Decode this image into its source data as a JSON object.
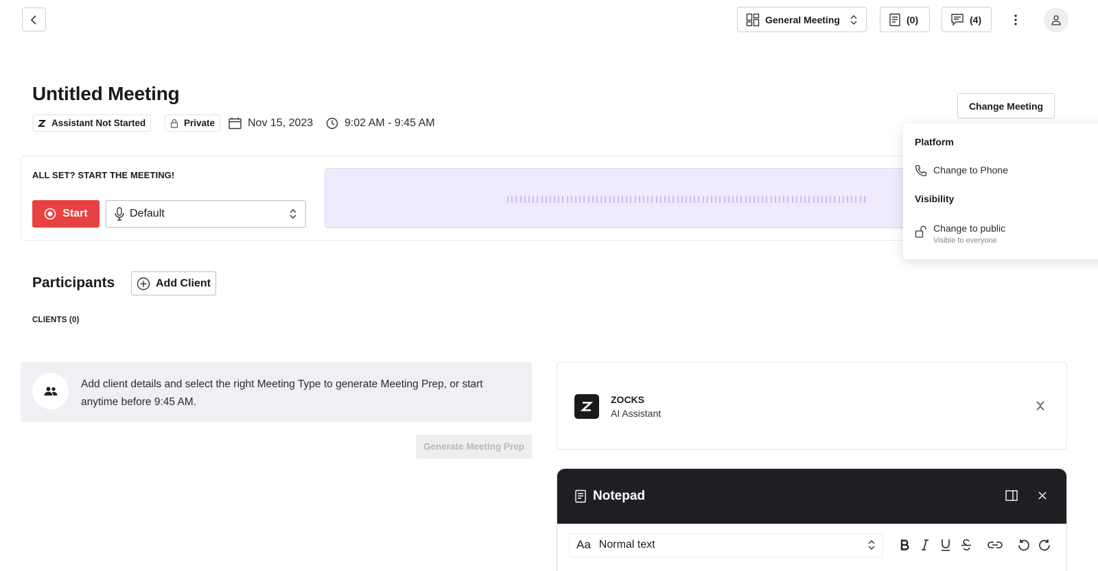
{
  "topbar": {
    "meeting_type": "General Meeting",
    "notes_count": "(0)",
    "comments_count": "(4)"
  },
  "meeting": {
    "title": "Untitled Meeting",
    "assistant_status": "Assistant Not Started",
    "privacy": "Private",
    "date": "Nov 15, 2023",
    "time": "9:02 AM - 9:45 AM",
    "change_meeting_label": "Change Meeting"
  },
  "start_panel": {
    "heading": "ALL SET? START THE MEETING!",
    "start_label": "Start",
    "mic_value": "Default"
  },
  "menu": {
    "platform_heading": "Platform",
    "change_phone": "Change to Phone",
    "visibility_heading": "Visibility",
    "change_public": "Change to public",
    "change_public_sub": "Visible to everyone"
  },
  "participants": {
    "heading": "Participants",
    "add_client_label": "Add Client",
    "clients_label": "CLIENTS (0)",
    "info_text": "Add client details and select the right Meeting Type to generate Meeting Prep, or start anytime before 9:45 AM.",
    "generate_label": "Generate Meeting Prep"
  },
  "assistant_card": {
    "name": "ZOCKS",
    "subtitle": "AI Assistant"
  },
  "notepad": {
    "title": "Notepad",
    "text_style_prefix": "Aa",
    "text_style": "Normal text"
  },
  "colors": {
    "start_red": "#e84141",
    "wave_bg": "#efeafc",
    "notepad_header": "#1e1f22"
  }
}
